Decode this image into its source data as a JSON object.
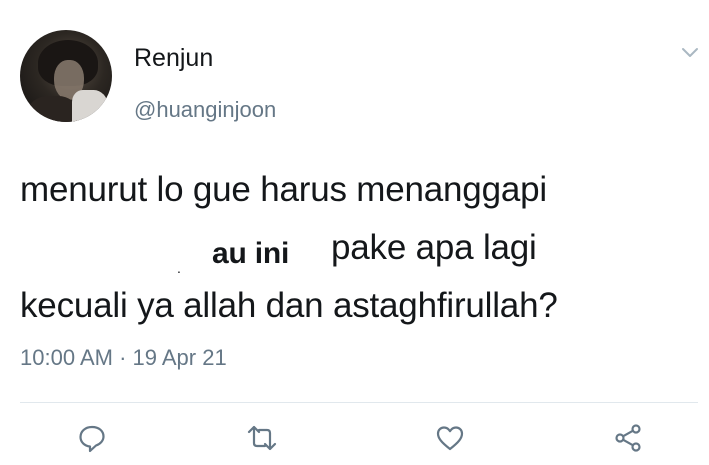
{
  "tweet": {
    "display_name": "Renjun",
    "handle": "@huanginjoon",
    "text_lines": [
      "menurut lo gue harus menanggapi",
      "pake apa lagi",
      "kecuali ya allah dan astaghfirullah?"
    ],
    "inserted_text": "au ini",
    "stray_mark": ".",
    "timestamp": "10:00 AM · 19 Apr 21"
  },
  "icons": {
    "menu": "chevron-down-icon",
    "reply": "reply-icon",
    "retweet": "retweet-icon",
    "like": "heart-icon",
    "share": "share-icon"
  },
  "colors": {
    "text_primary": "#14171a",
    "text_secondary": "#657786",
    "icon": "#657786",
    "divider": "#e1e8ed"
  }
}
